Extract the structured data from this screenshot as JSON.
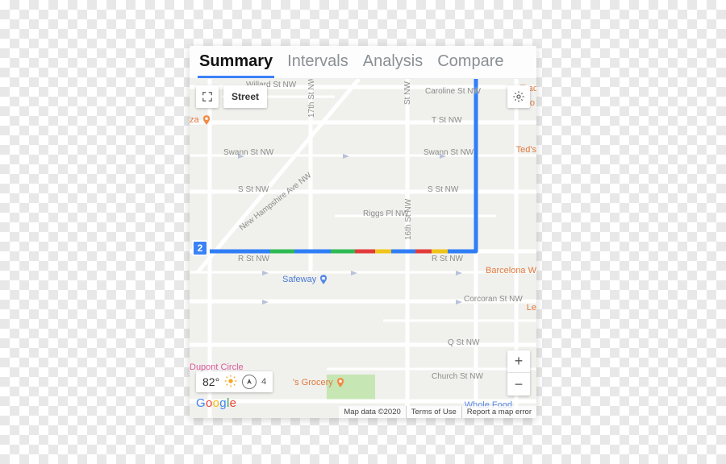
{
  "tabs": {
    "summary": "Summary",
    "intervals": "Intervals",
    "analysis": "Analysis",
    "compare": "Compare",
    "active": "summary"
  },
  "controls": {
    "maptype_label": "Street",
    "zoom_in": "+",
    "zoom_out": "−"
  },
  "weather": {
    "temperature": "82°",
    "wind_value": "4"
  },
  "route": {
    "end_marker": "2"
  },
  "streets": {
    "willard": "Willard St NW",
    "caroline": "Caroline St NW",
    "t": "T St NW",
    "swann_l": "Swann St NW",
    "swann_r": "Swann St NW",
    "s_l": "S St NW",
    "s_r": "S St NW",
    "riggs": "Riggs Pl NW",
    "r_l": "R St NW",
    "r_r": "R St NW",
    "corcoran": "Corcoran St NW",
    "q": "Q St NW",
    "church": "Church St NW",
    "seventeenth": "17th St NW",
    "sixteenth": "16th St NW",
    "newhampshire": "New Hampshire Ave NW",
    "st_nw": "St NW"
  },
  "pois": {
    "pizza": "za",
    "teds": "Ted's",
    "trader": "Trad",
    "co": "Co",
    "safeway": "Safeway",
    "barcelona": "Barcelona W",
    "le": "Le",
    "dupont": "Dupont Circle",
    "grocery": "'s Grocery",
    "wholefoods": "Whole Food"
  },
  "attribution": {
    "mapdata": "Map data ©2020",
    "terms": "Terms of Use",
    "report": "Report a map error"
  },
  "logo": "Google"
}
